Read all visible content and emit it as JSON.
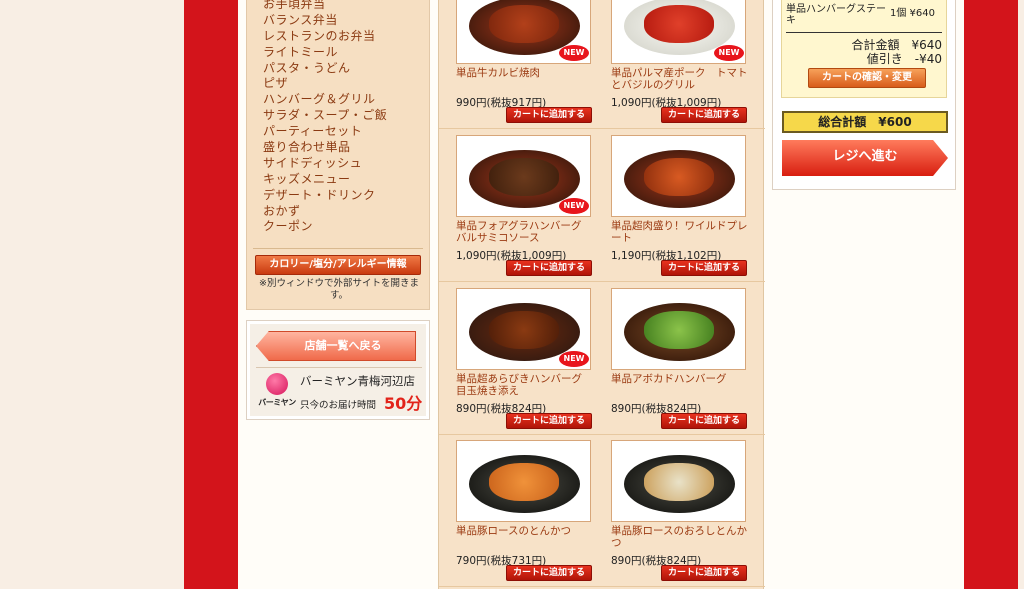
{
  "sidebar": {
    "categories": [
      "お手頃弁当",
      "バランス弁当",
      "レストランのお弁当",
      "ライトミール",
      "パスタ・うどん",
      "ピザ",
      "ハンバーグ＆グリル",
      "サラダ・スープ・ご飯",
      "パーティーセット",
      "盛り合わせ単品",
      "サイドディッシュ",
      "キッズメニュー",
      "デザート・ドリンク",
      "おかず",
      "クーポン"
    ],
    "calorie_button": "カロリー/塩分/アレルギー情報",
    "external_note": "※別ウィンドウで外部サイトを開きます。"
  },
  "store": {
    "back_button": "店舗一覧へ戻る",
    "logo_text": "バーミヤン",
    "name": "バーミヤン青梅河辺店",
    "delivery_label": "只今のお届け時間",
    "delivery_time": "50分"
  },
  "products": [
    {
      "name": "単品牛カルビ焼肉",
      "price": "990円(税抜917円)",
      "is_new": true,
      "button": "カートに追加する"
    },
    {
      "name": "単品パルマ産ポーク　トマトとバジルのグリル",
      "price": "1,090円(税抜1,009円)",
      "is_new": true,
      "button": "カートに追加する"
    },
    {
      "name": "単品フォアグラハンバーグ　バルサミコソース",
      "price": "1,090円(税抜1,009円)",
      "is_new": true,
      "button": "カートに追加する"
    },
    {
      "name": "単品超肉盛り！ワイルドプレート",
      "price": "1,190円(税抜1,102円)",
      "is_new": false,
      "button": "カートに追加する"
    },
    {
      "name": "単品超あらびきハンバーグ　目玉焼き添え",
      "price": "890円(税抜824円)",
      "is_new": true,
      "button": "カートに追加する"
    },
    {
      "name": "単品アボカドハンバーグ",
      "price": "890円(税抜824円)",
      "is_new": false,
      "button": "カートに追加する"
    },
    {
      "name": "単品豚ロースのとんかつ",
      "price": "790円(税抜731円)",
      "is_new": false,
      "button": "カートに追加する"
    },
    {
      "name": "単品豚ロースのおろしとんかつ",
      "price": "890円(税抜824円)",
      "is_new": false,
      "button": "カートに追加する"
    }
  ],
  "cart": {
    "item_name": "単品ハンバーグステーキ",
    "item_qty": "1個 ¥640",
    "subtotal": "合計金額　¥640",
    "discount": "値引き　-¥40",
    "confirm_button": "カートの確認・変更",
    "grand_total": "総合計額　¥600",
    "checkout_button": "レジへ進む"
  },
  "colors": {
    "brand_red": "#d3141b",
    "category_text": "#8b3a12",
    "delivery_highlight": "#e2231a",
    "total_bar": "#f6d84a"
  }
}
